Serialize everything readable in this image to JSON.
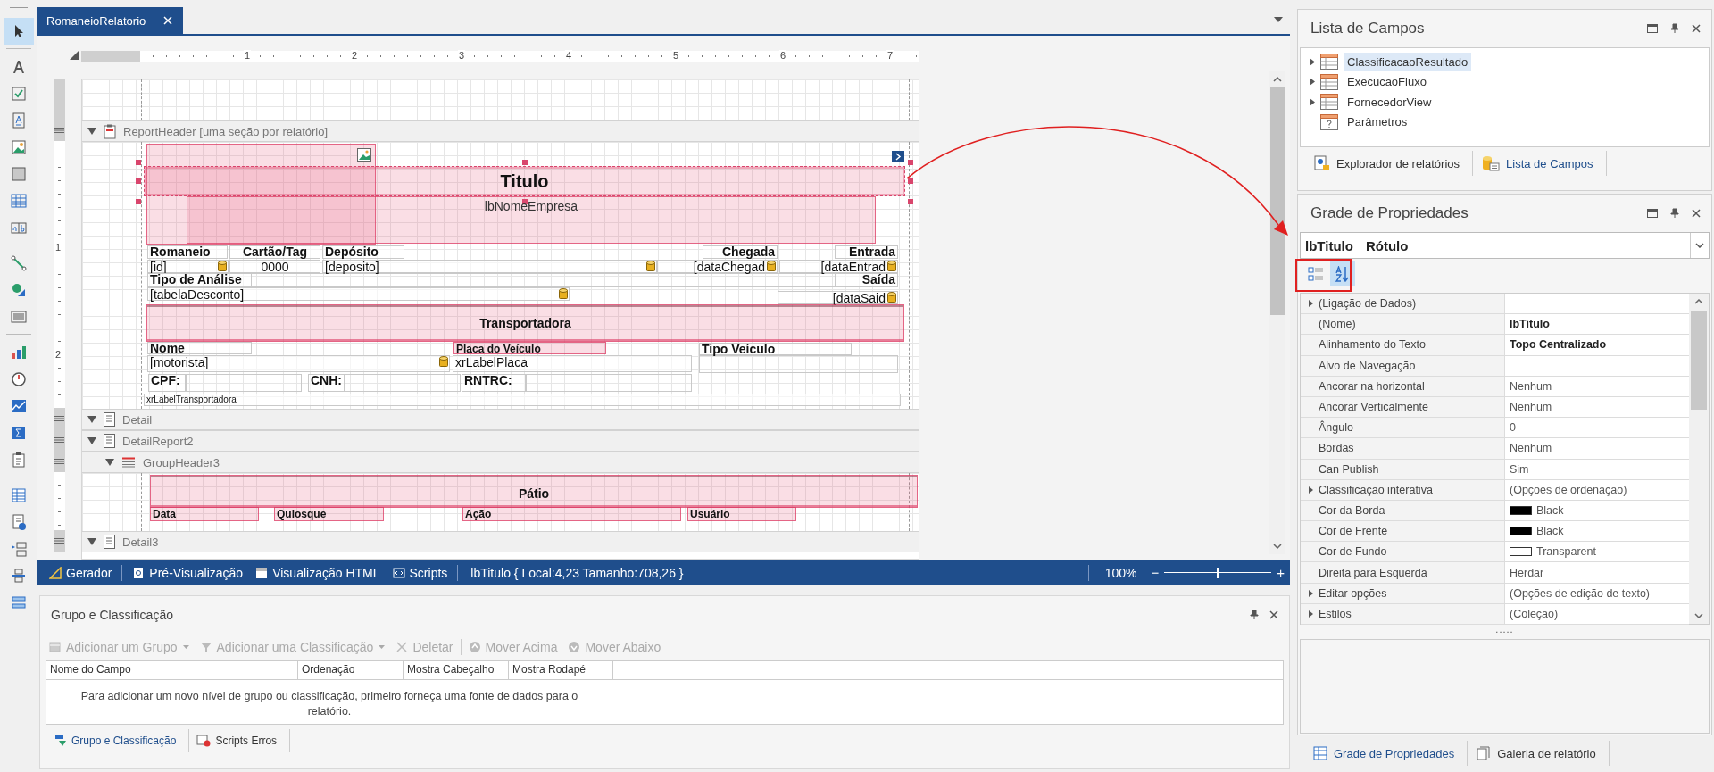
{
  "toolbox": [
    {
      "kind": "pointer",
      "selected": true
    },
    {
      "kind": "text",
      "selected": false
    },
    {
      "kind": "checkbox",
      "selected": false
    },
    {
      "kind": "label",
      "selected": false
    },
    {
      "kind": "picture",
      "selected": false
    },
    {
      "kind": "panel",
      "selected": false
    },
    {
      "kind": "table",
      "selected": false
    },
    {
      "kind": "charfield",
      "selected": false
    },
    {
      "kind": "line",
      "selected": false
    },
    {
      "kind": "shape",
      "selected": false
    },
    {
      "kind": "barcode",
      "selected": false
    },
    {
      "kind": "chart",
      "selected": false
    },
    {
      "kind": "gauge",
      "selected": false
    },
    {
      "kind": "sparkline",
      "selected": false
    },
    {
      "kind": "summary",
      "selected": false
    },
    {
      "kind": "clipboard",
      "selected": false
    },
    {
      "kind": "grid",
      "selected": false
    },
    {
      "kind": "info",
      "selected": false
    },
    {
      "kind": "subreport",
      "selected": false
    },
    {
      "kind": "pagebreak",
      "selected": false
    },
    {
      "kind": "bands",
      "selected": false
    }
  ],
  "document_tab": {
    "title": "RomaneioRelatorio",
    "selected": true
  },
  "ruler": {
    "horizontal": [
      "1",
      "2",
      "3",
      "4",
      "5",
      "6",
      "7"
    ],
    "vertical": [
      "1",
      "2"
    ]
  },
  "bands": [
    {
      "label": "ReportHeader [uma seção por relatório]",
      "kind": "header",
      "controls": [
        {
          "kind": "picture",
          "selected": false
        },
        {
          "kind": "title",
          "text": "Titulo",
          "selected": true
        },
        {
          "kind": "subtitle",
          "text": "lbNomeEmpresa",
          "selected": false
        },
        {
          "kind": "caption",
          "text": "Romaneio",
          "selected": false
        },
        {
          "kind": "caption",
          "text": "Cartão/Tag",
          "selected": false
        },
        {
          "kind": "caption",
          "text": "Depósito",
          "selected": false
        },
        {
          "kind": "caption",
          "text": "Chegada",
          "selected": false
        },
        {
          "kind": "caption",
          "text": "Entrada",
          "selected": false
        },
        {
          "kind": "field",
          "text": "[id]",
          "bound": true,
          "selected": false
        },
        {
          "kind": "field",
          "text": "0000",
          "bound": false,
          "selected": false
        },
        {
          "kind": "field",
          "text": "[deposito]",
          "bound": true,
          "selected": false
        },
        {
          "kind": "field",
          "text": "[dataChegad",
          "bound": true,
          "selected": false
        },
        {
          "kind": "field",
          "text": "[dataEntrad",
          "bound": true,
          "selected": false
        },
        {
          "kind": "caption",
          "text": "Tipo de Análise",
          "selected": false
        },
        {
          "kind": "caption",
          "text": "Saída",
          "selected": false
        },
        {
          "kind": "field",
          "text": "[tabelaDesconto]",
          "bound": true,
          "selected": false
        },
        {
          "kind": "field",
          "text": "[dataSaid",
          "bound": true,
          "selected": false
        },
        {
          "kind": "band",
          "text": "Transportadora",
          "selected": false
        },
        {
          "kind": "caption",
          "text": "Nome",
          "selected": false
        },
        {
          "kind": "marked",
          "text": "Placa do Veículo",
          "selected": false
        },
        {
          "kind": "caption",
          "text": "Tipo Veículo",
          "selected": false
        },
        {
          "kind": "field",
          "text": "[motorista]",
          "bound": true,
          "selected": false
        },
        {
          "kind": "field",
          "text": "xrLabelPlaca",
          "bound": false,
          "selected": false
        },
        {
          "kind": "caption",
          "text": "CPF:",
          "selected": false
        },
        {
          "kind": "caption",
          "text": "CNH:",
          "selected": false
        },
        {
          "kind": "caption",
          "text": "RNTRC:",
          "selected": false
        },
        {
          "kind": "small",
          "text": "xrLabelTransportadora",
          "selected": false
        }
      ]
    },
    {
      "label": "Detail",
      "kind": "detail"
    },
    {
      "label": "DetailReport2",
      "kind": "detail"
    },
    {
      "label": "GroupHeader3",
      "kind": "group",
      "controls": [
        {
          "kind": "band",
          "text": "Pátio",
          "selected": false
        },
        {
          "kind": "marked",
          "text": "Data",
          "selected": false
        },
        {
          "kind": "marked",
          "text": "Quiosque",
          "selected": false
        },
        {
          "kind": "marked",
          "text": "Ação",
          "selected": false
        },
        {
          "kind": "marked",
          "text": "Usuário",
          "selected": false
        }
      ]
    },
    {
      "label": "Detail3",
      "kind": "detail"
    }
  ],
  "status_bar": {
    "views": [
      {
        "kind": "designer",
        "label": "Gerador"
      },
      {
        "kind": "preview",
        "label": "Pré-Visualização"
      },
      {
        "kind": "html",
        "label": "Visualização HTML"
      },
      {
        "kind": "scripts",
        "label": "Scripts"
      }
    ],
    "selection": "lbTitulo { Local:4,23 Tamanho:708,26 }",
    "zoom": {
      "reading": "100%",
      "minus": "−",
      "plus": "+",
      "level": 0.5
    }
  },
  "group_panel": {
    "title": "Grupo e Classificação",
    "toolbar": [
      {
        "kind": "add-group",
        "label": "Adicionar um Grupo",
        "dropdown": true,
        "disabled": true
      },
      {
        "kind": "add-sort",
        "label": "Adicionar uma Classificação",
        "dropdown": true,
        "disabled": true
      },
      {
        "kind": "delete",
        "label": "Deletar",
        "dropdown": false,
        "disabled": true
      },
      {
        "kind": "up",
        "label": "Mover Acima",
        "dropdown": false,
        "disabled": true
      },
      {
        "kind": "down",
        "label": "Mover Abaixo",
        "dropdown": false,
        "disabled": true
      }
    ],
    "columns": [
      "Nome do Campo",
      "Ordenação",
      "Mostra Cabeçalho",
      "Mostra Rodapé"
    ],
    "message": "Para adicionar um novo nível de grupo ou classificação, primeiro forneça uma fonte de dados para o relatório.",
    "tabs": [
      {
        "kind": "group",
        "label": "Grupo e Classificação",
        "selected": true
      },
      {
        "kind": "errors",
        "label": "Scripts Erros",
        "selected": false
      }
    ]
  },
  "field_list": {
    "title": "Lista de Campos",
    "items": [
      {
        "kind": "table",
        "label": "ClassificacaoResultado",
        "expandable": true,
        "selected": true
      },
      {
        "kind": "table",
        "label": "ExecucaoFluxo",
        "expandable": true,
        "selected": false
      },
      {
        "kind": "table",
        "label": "FornecedorView",
        "expandable": true,
        "selected": false
      },
      {
        "kind": "parameters",
        "label": "Parâmetros",
        "expandable": false,
        "selected": false
      }
    ],
    "tabs": [
      {
        "kind": "explorer",
        "label": "Explorador de relatórios",
        "selected": false
      },
      {
        "kind": "fields",
        "label": "Lista de Campos",
        "selected": true
      }
    ]
  },
  "property_grid": {
    "title": "Grade de Propriedades",
    "object_name": "lbTitulo",
    "object_type": "Rótulo",
    "sort": [
      {
        "kind": "categorized",
        "selected": false
      },
      {
        "kind": "alphabetical",
        "selected": true
      }
    ],
    "rows": [
      {
        "name": "(Ligação de Dados)",
        "expandable": true
      },
      {
        "name": "(Nome)",
        "value": "lbTitulo",
        "expandable": false,
        "changed": true
      },
      {
        "name": "Alinhamento do Texto",
        "value": "Topo Centralizado",
        "expandable": false,
        "changed": true
      },
      {
        "name": "Alvo de Navegação",
        "expandable": false
      },
      {
        "name": "Ancorar na horizontal",
        "value": "Nenhum",
        "expandable": false,
        "changed": false
      },
      {
        "name": "Ancorar Verticalmente",
        "value": "Nenhum",
        "expandable": false,
        "changed": false
      },
      {
        "name": "Ângulo",
        "value": "0",
        "expandable": false,
        "changed": false
      },
      {
        "name": "Bordas",
        "value": "Nenhum",
        "expandable": false,
        "changed": false
      },
      {
        "name": "Can Publish",
        "value": "Sim",
        "expandable": false,
        "changed": false
      },
      {
        "name": "Classificação interativa",
        "value": "(Opções de ordenação)",
        "expandable": true,
        "changed": false
      },
      {
        "name": "Cor da Borda",
        "value": "Black",
        "color": "#000000",
        "expandable": false,
        "changed": false
      },
      {
        "name": "Cor de Frente",
        "value": "Black",
        "color": "#000000",
        "expandable": false,
        "changed": false
      },
      {
        "name": "Cor de Fundo",
        "value": "Transparent",
        "color": "#ffffff",
        "expandable": false,
        "changed": false
      },
      {
        "name": "Direita para Esquerda",
        "value": "Herdar",
        "expandable": false,
        "changed": false
      },
      {
        "name": "Editar opções",
        "value": "(Opções de edição de texto)",
        "expandable": true,
        "changed": false
      },
      {
        "name": "Estilos",
        "value": "(Coleção)",
        "expandable": true,
        "changed": false
      }
    ],
    "splitter": ".....",
    "tabs": [
      {
        "kind": "grid",
        "label": "Grade de Propriedades",
        "selected": true
      },
      {
        "kind": "gallery",
        "label": "Galeria de relatório",
        "selected": false
      }
    ]
  }
}
